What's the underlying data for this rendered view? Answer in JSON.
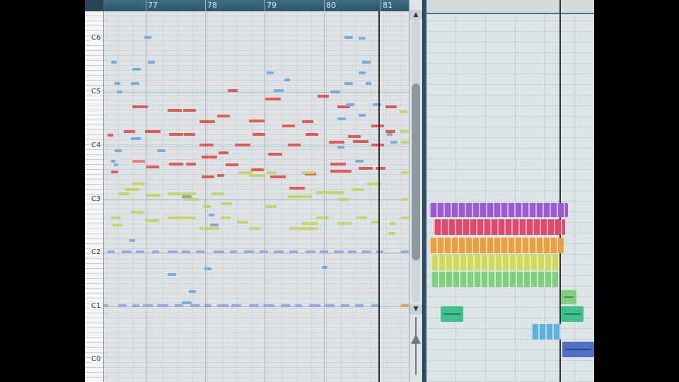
{
  "piano_roll": {
    "bar_numbers": [
      "77",
      "78",
      "79",
      "80",
      "81"
    ],
    "octave_labels": [
      "C6",
      "C5",
      "C4",
      "C3",
      "C2",
      "C1",
      "C0"
    ]
  },
  "colors": {
    "lead_notes": "#e05a5a",
    "mid_notes": "#7aaed6",
    "chord_notes": "#c8d46a",
    "bass_notes": "#9ea6e0",
    "clip_purple": "#9a5ad0",
    "clip_red": "#e04a6a",
    "clip_orange": "#e8a040",
    "clip_yellow": "#d0d860",
    "clip_green": "#80d080",
    "clip_teal": "#40c090",
    "clip_cyan": "#60b0e0",
    "clip_blue": "#5070c8"
  },
  "icons": {
    "scroll_up": "▲",
    "scroll_down": "▼"
  }
}
